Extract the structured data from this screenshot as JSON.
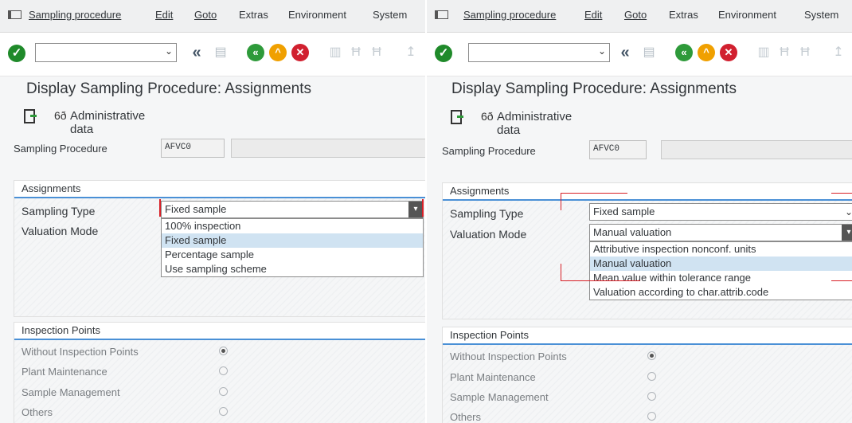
{
  "panels": [
    {
      "menu": [
        "Sampling procedure",
        "Edit",
        "Goto",
        "Extras",
        "Environment",
        "System"
      ],
      "title": "Display Sampling Procedure: Assignments",
      "admin_label": "Administrative data",
      "sampling_procedure_label": "Sampling Procedure",
      "sampling_procedure_value": "AFVC0",
      "assignments_title": "Assignments",
      "sampling_type_label": "Sampling Type",
      "sampling_type_value": "Fixed sample",
      "valuation_mode_label": "Valuation Mode",
      "valuation_mode_value": "",
      "dropdown_items": [
        "100% inspection",
        "Fixed sample",
        "Percentage sample",
        "Use sampling scheme"
      ],
      "dropdown_selected": "Fixed sample",
      "inspection_points_title": "Inspection Points",
      "inspection_points": [
        {
          "label": "Without Inspection Points",
          "selected": true
        },
        {
          "label": "Plant Maintenance",
          "selected": false
        },
        {
          "label": "Sample Management",
          "selected": false
        },
        {
          "label": "Others",
          "selected": false
        }
      ]
    },
    {
      "menu": [
        "Sampling procedure",
        "Edit",
        "Goto",
        "Extras",
        "Environment",
        "System"
      ],
      "title": "Display Sampling Procedure: Assignments",
      "admin_label": "Administrative data",
      "sampling_procedure_label": "Sampling Procedure",
      "sampling_procedure_value": "AFVC0",
      "assignments_title": "Assignments",
      "sampling_type_label": "Sampling Type",
      "sampling_type_value": "Fixed sample",
      "valuation_mode_label": "Valuation Mode",
      "valuation_mode_value": "Manual valuation",
      "dropdown_items": [
        "Attributive inspection nonconf. units",
        "Manual valuation",
        "Mean value within tolerance range",
        "Valuation according to char.attrib.code"
      ],
      "dropdown_selected": "Manual valuation",
      "inspection_points_title": "Inspection Points",
      "inspection_points": [
        {
          "label": "Without Inspection Points",
          "selected": true
        },
        {
          "label": "Plant Maintenance",
          "selected": false
        },
        {
          "label": "Sample Management",
          "selected": false
        },
        {
          "label": "Others",
          "selected": false
        }
      ]
    }
  ],
  "icons": {
    "ok": "green-check-icon",
    "back": "double-chevron-left-icon",
    "save": "save-icon",
    "nav_back": "green-back-icon",
    "nav_exit": "yellow-exit-icon",
    "nav_cancel": "red-cancel-icon",
    "print": "print-icon",
    "find": "find-icon",
    "find_next": "find-next-icon",
    "execute": "execute-icon",
    "glasses": "glasses-icon"
  },
  "colors": {
    "accent": "#4a90d6",
    "highlight": "#d0e3f2",
    "ok_green": "#2e9a3a",
    "annotation_red": "#d81f26"
  }
}
